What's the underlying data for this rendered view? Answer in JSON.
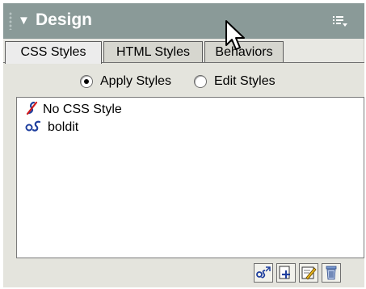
{
  "panel": {
    "title": "Design",
    "tabs": [
      {
        "label": "CSS Styles",
        "active": true
      },
      {
        "label": "HTML Styles",
        "active": false
      },
      {
        "label": "Behaviors",
        "active": false
      }
    ]
  },
  "mode": {
    "options": [
      {
        "label": "Apply Styles",
        "selected": true
      },
      {
        "label": "Edit Styles",
        "selected": false
      }
    ]
  },
  "styles_list": {
    "items": [
      {
        "label": "No CSS Style",
        "icon": "no-style-icon"
      },
      {
        "label": "boldit",
        "icon": "css-style-icon"
      }
    ]
  },
  "toolbar": {
    "buttons": [
      {
        "name": "attach-style-sheet-button",
        "icon": "attach-stylesheet-icon"
      },
      {
        "name": "new-style-button",
        "icon": "new-style-icon"
      },
      {
        "name": "edit-style-button",
        "icon": "edit-style-icon"
      },
      {
        "name": "delete-style-button",
        "icon": "trash-icon"
      }
    ]
  },
  "colors": {
    "titlebar": "#8a9a98",
    "panel_background": "#e8e8e3",
    "list_background": "#ffffff"
  }
}
